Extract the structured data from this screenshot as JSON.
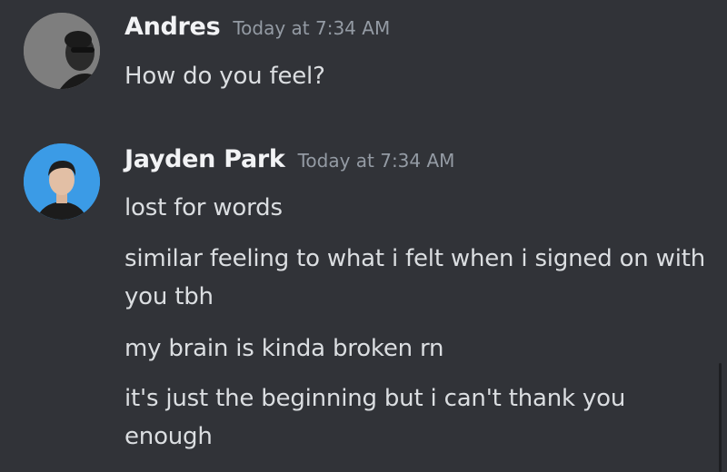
{
  "messages": [
    {
      "author": "Andres",
      "timestamp": "Today at 7:34 AM",
      "lines": [
        "How do you feel?"
      ]
    },
    {
      "author": "Jayden Park",
      "timestamp": "Today at 7:34 AM",
      "lines": [
        "lost for words",
        "similar feeling to what i felt when i signed on with you tbh",
        "my brain is kinda broken rn",
        "it's just the beginning but i can't thank you enough"
      ]
    }
  ],
  "colors": {
    "background": "#313338",
    "username": "#f2f3f5",
    "timestamp": "#949ba4",
    "text": "#dbdee1",
    "avatar_blue": "#3b9be6"
  }
}
